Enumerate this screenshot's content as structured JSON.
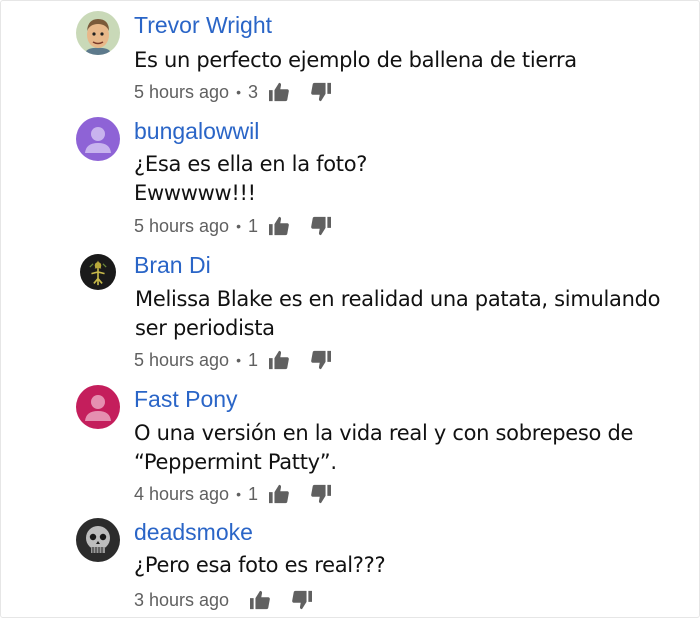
{
  "comments": [
    {
      "author": "Trevor Wright",
      "text_lines": [
        "Es un perfecto ejemplo de ballena de tierra"
      ],
      "time": "5 hours ago",
      "likes": "3",
      "avatar": {
        "icon": "cartoon-man-avatar",
        "bg": "#c9d9b8"
      }
    },
    {
      "author": "bungalowwil",
      "text_lines": [
        "¿Esa es ella en la foto?",
        "Ewwwww!!!"
      ],
      "time": "5 hours ago",
      "likes": "1",
      "avatar": {
        "icon": "default-user-avatar",
        "bg": "#8e63d6"
      }
    },
    {
      "author": "Bran Di",
      "text_lines": [
        "Melissa Blake es en realidad una patata, simulando",
        "ser periodista"
      ],
      "time": "5 hours ago",
      "likes": "1",
      "avatar": {
        "icon": "dark-figure-avatar",
        "bg": "#1a1a1a"
      }
    },
    {
      "author": "Fast Pony",
      "text_lines": [
        "O una versión en la vida real y con sobrepeso de",
        "“Peppermint  Patty”."
      ],
      "time": "4 hours ago",
      "likes": "1",
      "avatar": {
        "icon": "default-user-avatar",
        "bg": "#c41e5c"
      }
    },
    {
      "author": "deadsmoke",
      "text_lines": [
        "¿Pero esa foto es real???"
      ],
      "time": "3 hours ago",
      "likes": "",
      "avatar": {
        "icon": "skull-photo-avatar",
        "bg": "#2c2c2c"
      }
    }
  ],
  "colors": {
    "author": "#2a65c7",
    "text": "#111111",
    "meta": "#606060"
  }
}
